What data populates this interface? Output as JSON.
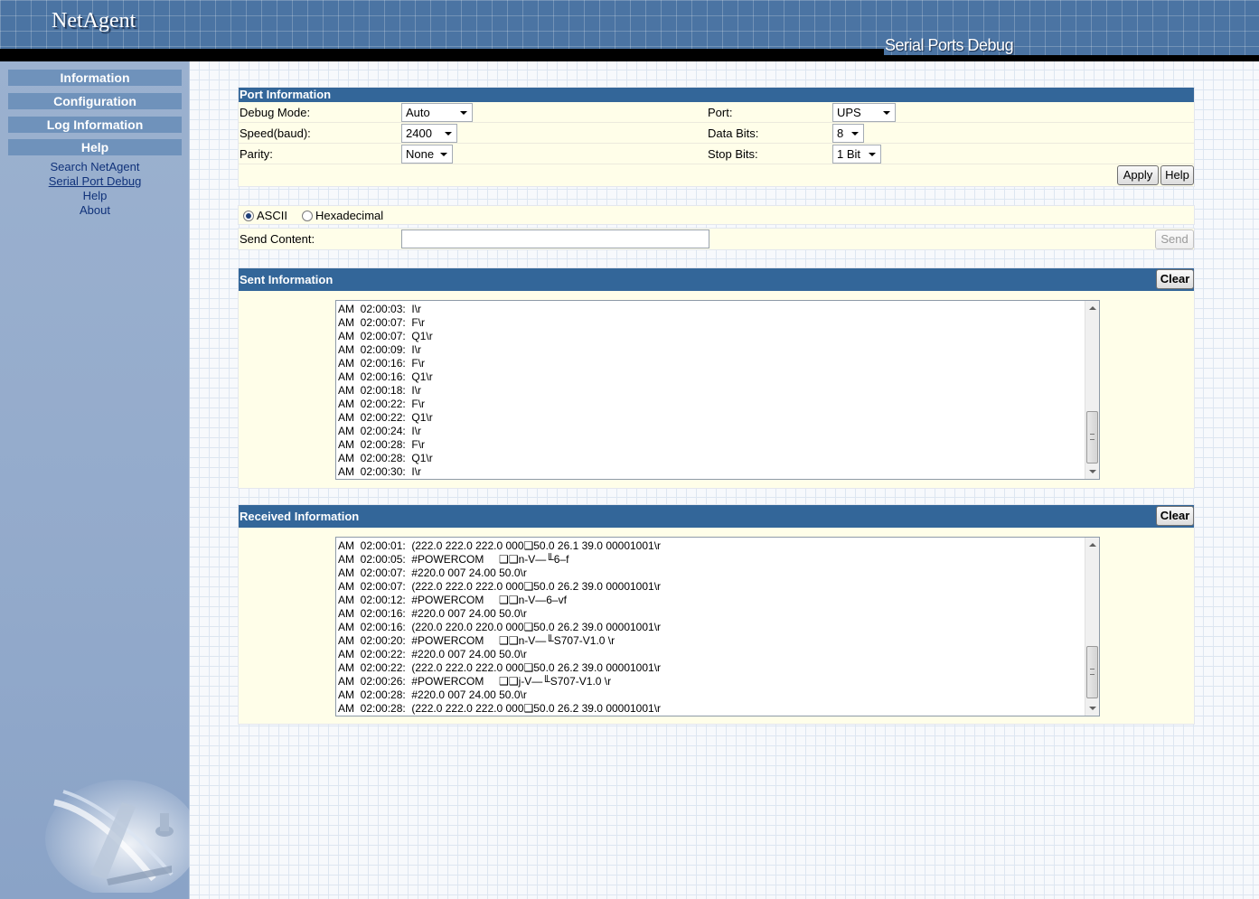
{
  "header": {
    "logo": "NetAgent",
    "page_title": "Serial Ports Debug"
  },
  "sidebar": {
    "menu": [
      "Information",
      "Configuration",
      "Log Information",
      "Help"
    ],
    "submenu": [
      "Search NetAgent",
      "Serial Port Debug",
      "Help",
      "About"
    ],
    "active_submenu": "Serial Port Debug"
  },
  "port_info": {
    "title": "Port Information",
    "debug_mode_label": "Debug Mode:",
    "debug_mode_value": "Auto",
    "port_label": "Port:",
    "port_value": "UPS",
    "speed_label": "Speed(baud):",
    "speed_value": "2400",
    "data_bits_label": "Data Bits:",
    "data_bits_value": "8",
    "parity_label": "Parity:",
    "parity_value": "None",
    "stop_bits_label": "Stop Bits:",
    "stop_bits_value": "1 Bit",
    "apply_label": "Apply",
    "help_label": "Help"
  },
  "send": {
    "ascii_label": "ASCII",
    "hex_label": "Hexadecimal",
    "selected_mode": "ASCII",
    "content_label": "Send Content:",
    "content_value": "",
    "send_label": "Send"
  },
  "sent": {
    "title": "Sent Information",
    "clear_label": "Clear",
    "lines": [
      "AM  02:00:03:  I\\r",
      "AM  02:00:07:  F\\r",
      "AM  02:00:07:  Q1\\r",
      "AM  02:00:09:  I\\r",
      "AM  02:00:16:  F\\r",
      "AM  02:00:16:  Q1\\r",
      "AM  02:00:18:  I\\r",
      "AM  02:00:22:  F\\r",
      "AM  02:00:22:  Q1\\r",
      "AM  02:00:24:  I\\r",
      "AM  02:00:28:  F\\r",
      "AM  02:00:28:  Q1\\r",
      "AM  02:00:30:  I\\r"
    ]
  },
  "received": {
    "title": "Received Information",
    "clear_label": "Clear",
    "lines": [
      "AM  02:00:01:  (222.0 222.0 222.0 000❑50.0 26.1 39.0 00001001\\r",
      "AM  02:00:05:  #POWERCOM     ❑❑n-V—╙6–f",
      "AM  02:00:07:  #220.0 007 24.00 50.0\\r",
      "AM  02:00:07:  (222.0 222.0 222.0 000❑50.0 26.2 39.0 00001001\\r",
      "AM  02:00:12:  #POWERCOM     ❑❑n-V—6–vf",
      "AM  02:00:16:  #220.0 007 24.00 50.0\\r",
      "AM  02:00:16:  (220.0 220.0 220.0 000❑50.0 26.2 39.0 00001001\\r",
      "AM  02:00:20:  #POWERCOM     ❑❑n-V—╙S707-V1.0 \\r",
      "AM  02:00:22:  #220.0 007 24.00 50.0\\r",
      "AM  02:00:22:  (222.0 222.0 222.0 000❑50.0 26.2 39.0 00001001\\r",
      "AM  02:00:26:  #POWERCOM     ❑❑j-V—╙S707-V1.0 \\r",
      "AM  02:00:28:  #220.0 007 24.00 50.0\\r",
      "AM  02:00:28:  (222.0 222.0 222.0 000❑50.0 26.2 39.0 00001001\\r"
    ]
  }
}
